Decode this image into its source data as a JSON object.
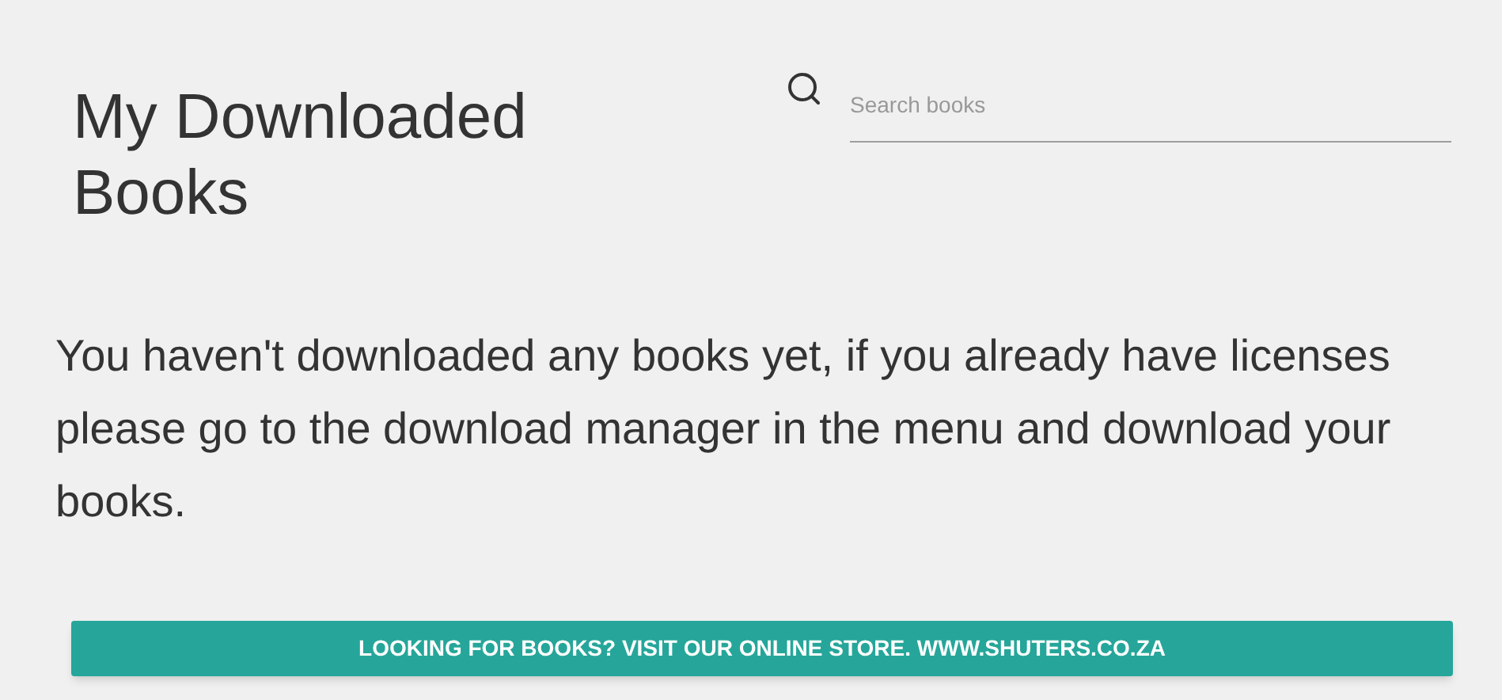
{
  "title": "My Downloaded Books",
  "search": {
    "placeholder": "Search books"
  },
  "message": "You haven't downloaded any books yet, if you already have licenses please go to the download manager in the menu and download your books.",
  "store_button": "LOOKING FOR BOOKS? VISIT OUR ONLINE STORE. WWW.SHUTERS.CO.ZA"
}
